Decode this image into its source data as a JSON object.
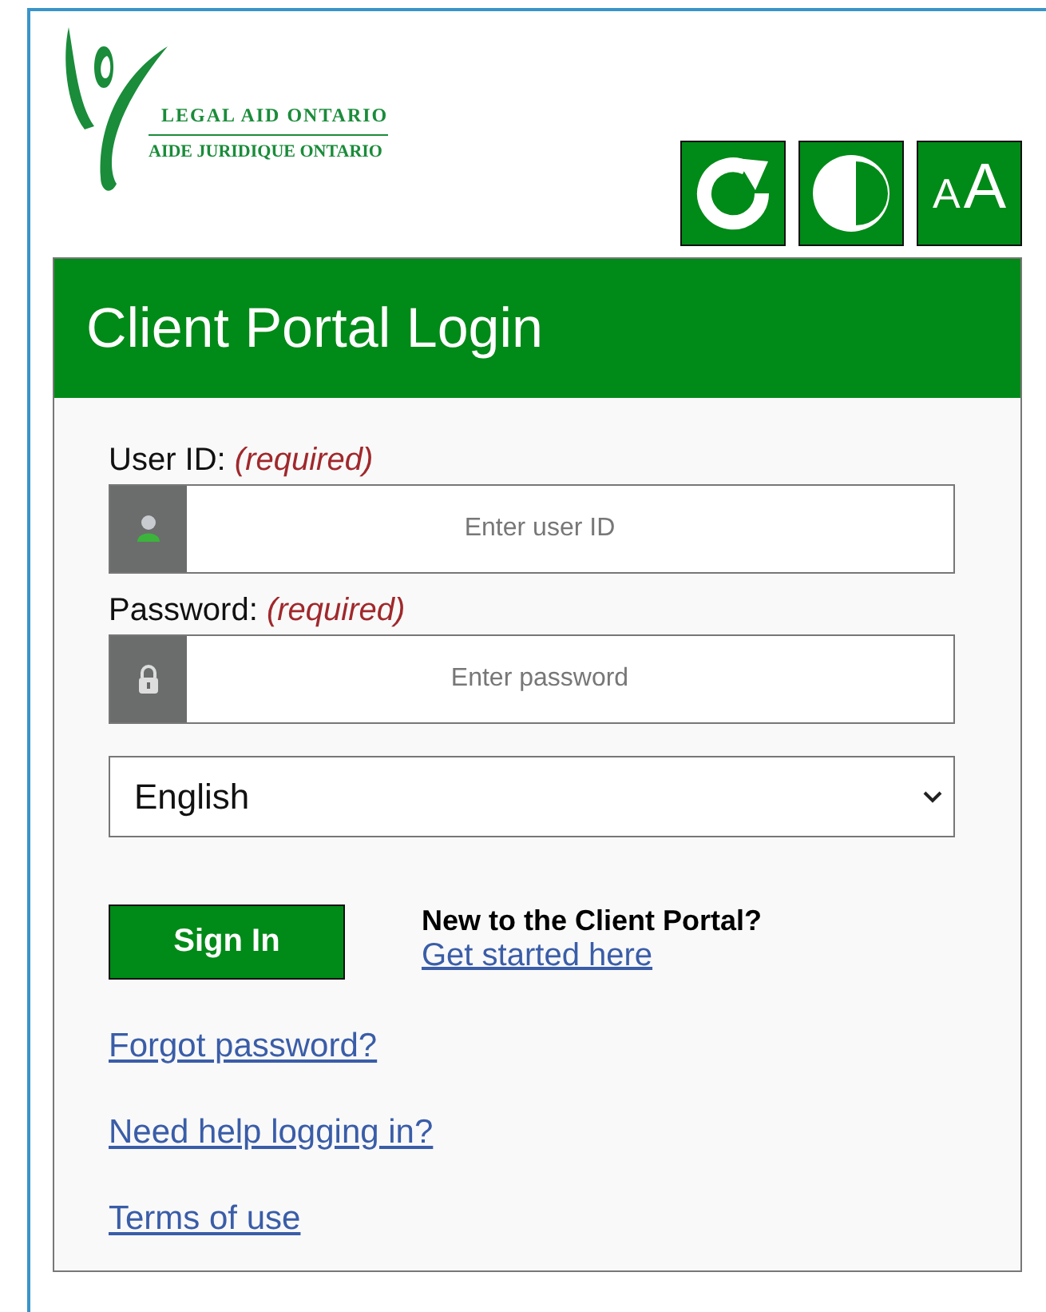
{
  "logo": {
    "line_1": "LEGAL AID ONTARIO",
    "line_2": "AIDE JURIDIQUE ONTARIO"
  },
  "tools": [
    {
      "kind": "reset"
    },
    {
      "kind": "contrast"
    },
    {
      "kind": "textsize",
      "small": "A",
      "large": "A"
    }
  ],
  "title": "Client Portal Login",
  "fields": [
    {
      "kind": "user",
      "label": "User ID:",
      "note": "(required)",
      "placeholder": "Enter user ID"
    },
    {
      "kind": "lock",
      "label": "Password:",
      "note": "(required)",
      "placeholder": "Enter password"
    }
  ],
  "language": "English",
  "sign_in": "Sign In",
  "new_heading": "New to the Client Portal?",
  "new_link": "Get started here",
  "links": [
    "Forgot password?",
    "Need help logging in?",
    "Terms of use"
  ]
}
